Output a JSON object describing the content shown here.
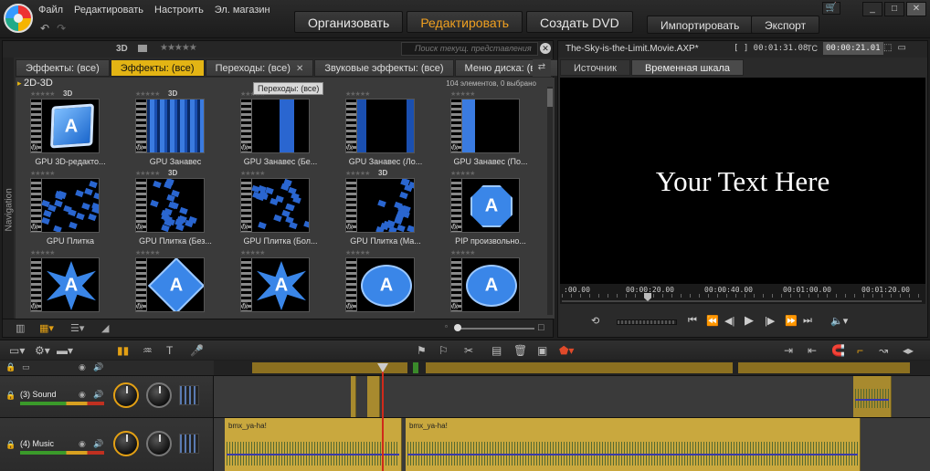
{
  "app": {
    "menu": [
      "Файл",
      "Редактировать",
      "Настроить",
      "Эл. магазин"
    ],
    "mode_tabs": [
      {
        "label": "Организовать",
        "active": false
      },
      {
        "label": "Редактировать",
        "active": true
      },
      {
        "label": "Создать DVD",
        "active": false
      }
    ],
    "import_label": "Импортировать",
    "export_label": "Экспорт",
    "accent_color": "#e3b414",
    "mode_active_color": "#f0a020"
  },
  "library": {
    "filter_3d": "3D",
    "search_placeholder": "Поиск текущ. представления",
    "navigation_label": "Navigation",
    "tabs": [
      {
        "label": "Эффекты: (все)",
        "active": false
      },
      {
        "label": "Эффекты: (все)",
        "active": true
      },
      {
        "label": "Переходы: (все)",
        "active": false,
        "closable": true
      },
      {
        "label": "Звуковые эффекты: (все)",
        "active": false
      },
      {
        "label": "Меню диска: (все)",
        "active": false
      }
    ],
    "tooltip": "Переходы: (все)",
    "group_title": "2D-3D",
    "count_text": "104 элементов, 0 выбрано",
    "items": [
      {
        "label": "GPU 3D-редакто...",
        "art": "3d",
        "is3d": true
      },
      {
        "label": "GPU Занавес",
        "art": "curtain",
        "is3d": true
      },
      {
        "label": "GPU Занавес (Бе...",
        "art": "curtain3",
        "is3d": false
      },
      {
        "label": "GPU Занавес (Ло...",
        "art": "curtain2",
        "is3d": false
      },
      {
        "label": "GPU Занавес (По...",
        "art": "curtain4",
        "is3d": false
      },
      {
        "label": "GPU Плитка",
        "art": "tile",
        "is3d": false
      },
      {
        "label": "GPU Плитка (Без...",
        "art": "tile",
        "is3d": true
      },
      {
        "label": "GPU Плитка (Бол...",
        "art": "tile",
        "is3d": false
      },
      {
        "label": "GPU Плитка (Ма...",
        "art": "tile",
        "is3d": true
      },
      {
        "label": "PIP произвольно...",
        "art": "oct",
        "is3d": false
      },
      {
        "label": "",
        "art": "star",
        "is3d": false
      },
      {
        "label": "",
        "art": "diamond",
        "is3d": false
      },
      {
        "label": "",
        "art": "star",
        "is3d": false
      },
      {
        "label": "",
        "art": "oval",
        "is3d": false
      },
      {
        "label": "",
        "art": "oval",
        "is3d": false
      }
    ],
    "thumb_letter": "A"
  },
  "player": {
    "filename": "The-Sky-is-the-Limit.Movie.AXP*",
    "duration": "[ ] 00:01:31.08",
    "tc_label": "TC",
    "timecode": "00:00:21.01",
    "tabs": [
      {
        "label": "Источник",
        "active": false
      },
      {
        "label": "Временная шкала",
        "active": true
      }
    ],
    "screen_text": "Your Text Here",
    "ruler": [
      ":00.00",
      "00:00:20.00",
      "00:00:40.00",
      "00:01:00.00",
      "00:01:20.00"
    ]
  },
  "timeline": {
    "tracks": [
      {
        "name": "(3) Sound"
      },
      {
        "name": "(4) Music"
      }
    ],
    "clips": [
      {
        "title": "bmx_ya-ha!"
      },
      {
        "title": "bmx_ya-ha!"
      }
    ],
    "playhead_color": "#d02a1a"
  }
}
